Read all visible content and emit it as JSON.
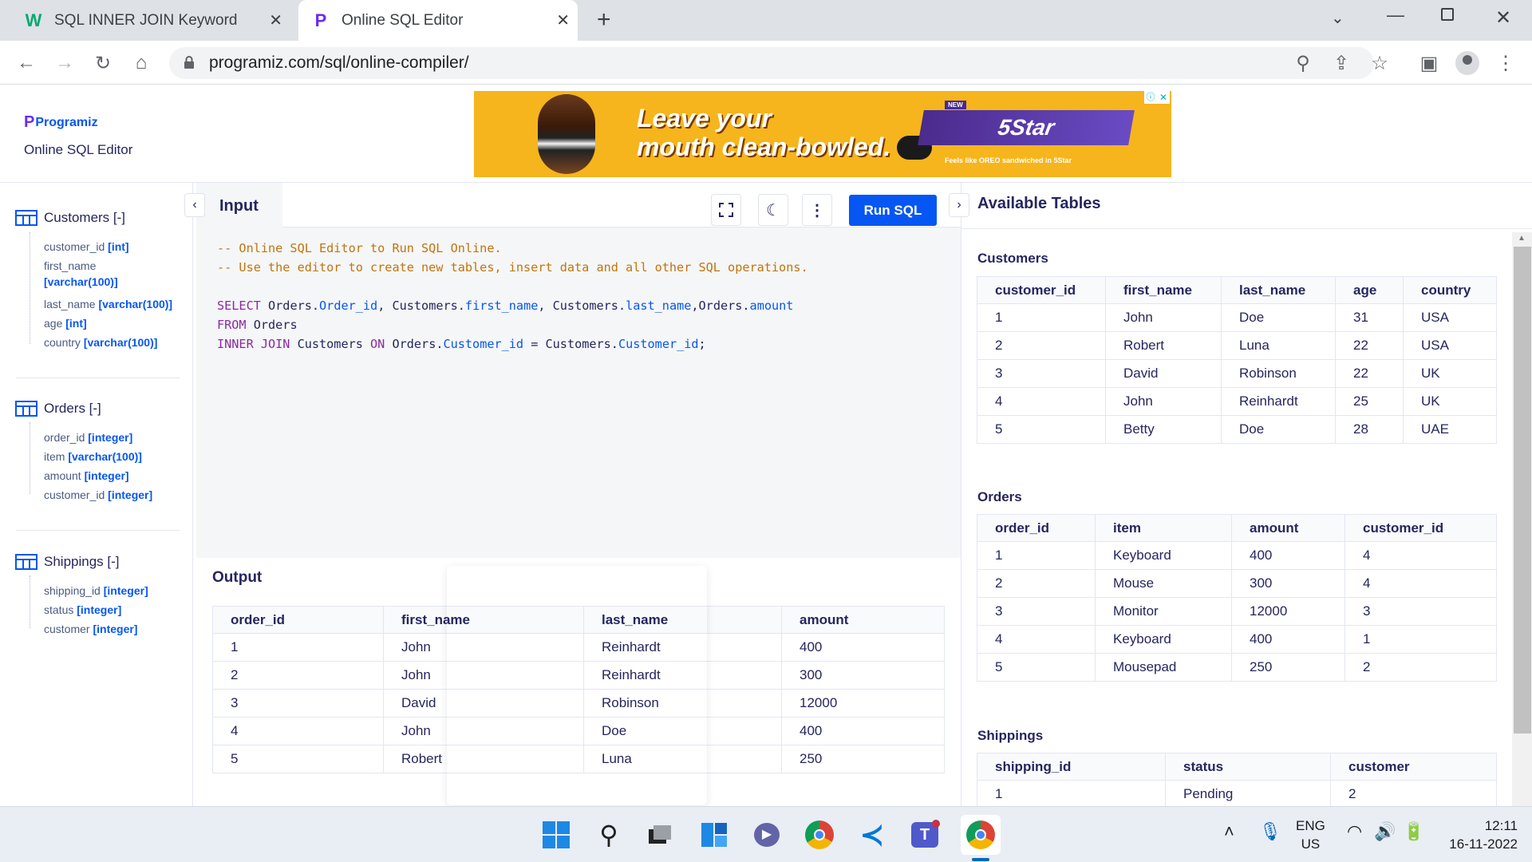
{
  "browser": {
    "tabs": [
      {
        "label": "SQL INNER JOIN Keyword",
        "favicon": "W"
      },
      {
        "label": "Online SQL Editor",
        "favicon": "P"
      }
    ],
    "url": "programiz.com/sql/online-compiler/"
  },
  "header": {
    "logo": "Programiz",
    "subtitle": "Online SQL Editor",
    "ad": {
      "headline_line1": "Leave your",
      "headline_line2": "mouth clean-bowled.",
      "badge": "NEW",
      "brand": "5Star",
      "tagline": "Feels like OREO sandwiched in 5Star"
    }
  },
  "sidebar": {
    "tables": [
      {
        "name": "Customers [-]",
        "fields": [
          {
            "name": "customer_id",
            "type": "[int]"
          },
          {
            "name": "first_name",
            "type": "[varchar(100)]"
          },
          {
            "name": "last_name",
            "type": "[varchar(100)]"
          },
          {
            "name": "age",
            "type": "[int]"
          },
          {
            "name": "country",
            "type": "[varchar(100)]"
          }
        ]
      },
      {
        "name": "Orders [-]",
        "fields": [
          {
            "name": "order_id",
            "type": "[integer]"
          },
          {
            "name": "item",
            "type": "[varchar(100)]"
          },
          {
            "name": "amount",
            "type": "[integer]"
          },
          {
            "name": "customer_id",
            "type": "[integer]"
          }
        ]
      },
      {
        "name": "Shippings [-]",
        "fields": [
          {
            "name": "shipping_id",
            "type": "[integer]"
          },
          {
            "name": "status",
            "type": "[integer]"
          },
          {
            "name": "customer",
            "type": "[integer]"
          }
        ]
      }
    ]
  },
  "editor": {
    "tab_label": "Input",
    "run_label": "Run SQL",
    "code": {
      "comment1": "-- Online SQL Editor to Run SQL Online.",
      "comment2": "-- Use the editor to create new tables, insert data and all other SQL operations."
    }
  },
  "output": {
    "title": "Output",
    "columns": [
      "order_id",
      "first_name",
      "last_name",
      "amount"
    ],
    "rows": [
      [
        "1",
        "John",
        "Reinhardt",
        "400"
      ],
      [
        "2",
        "John",
        "Reinhardt",
        "300"
      ],
      [
        "3",
        "David",
        "Robinson",
        "12000"
      ],
      [
        "4",
        "John",
        "Doe",
        "400"
      ],
      [
        "5",
        "Robert",
        "Luna",
        "250"
      ]
    ]
  },
  "available": {
    "title": "Available Tables",
    "customers": {
      "title": "Customers",
      "columns": [
        "customer_id",
        "first_name",
        "last_name",
        "age",
        "country"
      ],
      "rows": [
        [
          "1",
          "John",
          "Doe",
          "31",
          "USA"
        ],
        [
          "2",
          "Robert",
          "Luna",
          "22",
          "USA"
        ],
        [
          "3",
          "David",
          "Robinson",
          "22",
          "UK"
        ],
        [
          "4",
          "John",
          "Reinhardt",
          "25",
          "UK"
        ],
        [
          "5",
          "Betty",
          "Doe",
          "28",
          "UAE"
        ]
      ]
    },
    "orders": {
      "title": "Orders",
      "columns": [
        "order_id",
        "item",
        "amount",
        "customer_id"
      ],
      "rows": [
        [
          "1",
          "Keyboard",
          "400",
          "4"
        ],
        [
          "2",
          "Mouse",
          "300",
          "4"
        ],
        [
          "3",
          "Monitor",
          "12000",
          "3"
        ],
        [
          "4",
          "Keyboard",
          "400",
          "1"
        ],
        [
          "5",
          "Mousepad",
          "250",
          "2"
        ]
      ]
    },
    "shippings": {
      "title": "Shippings",
      "columns": [
        "shipping_id",
        "status",
        "customer"
      ],
      "rows": [
        [
          "1",
          "Pending",
          "2"
        ]
      ]
    }
  },
  "taskbar": {
    "lang1": "ENG",
    "lang2": "US",
    "time": "12:11",
    "date": "16-11-2022"
  }
}
